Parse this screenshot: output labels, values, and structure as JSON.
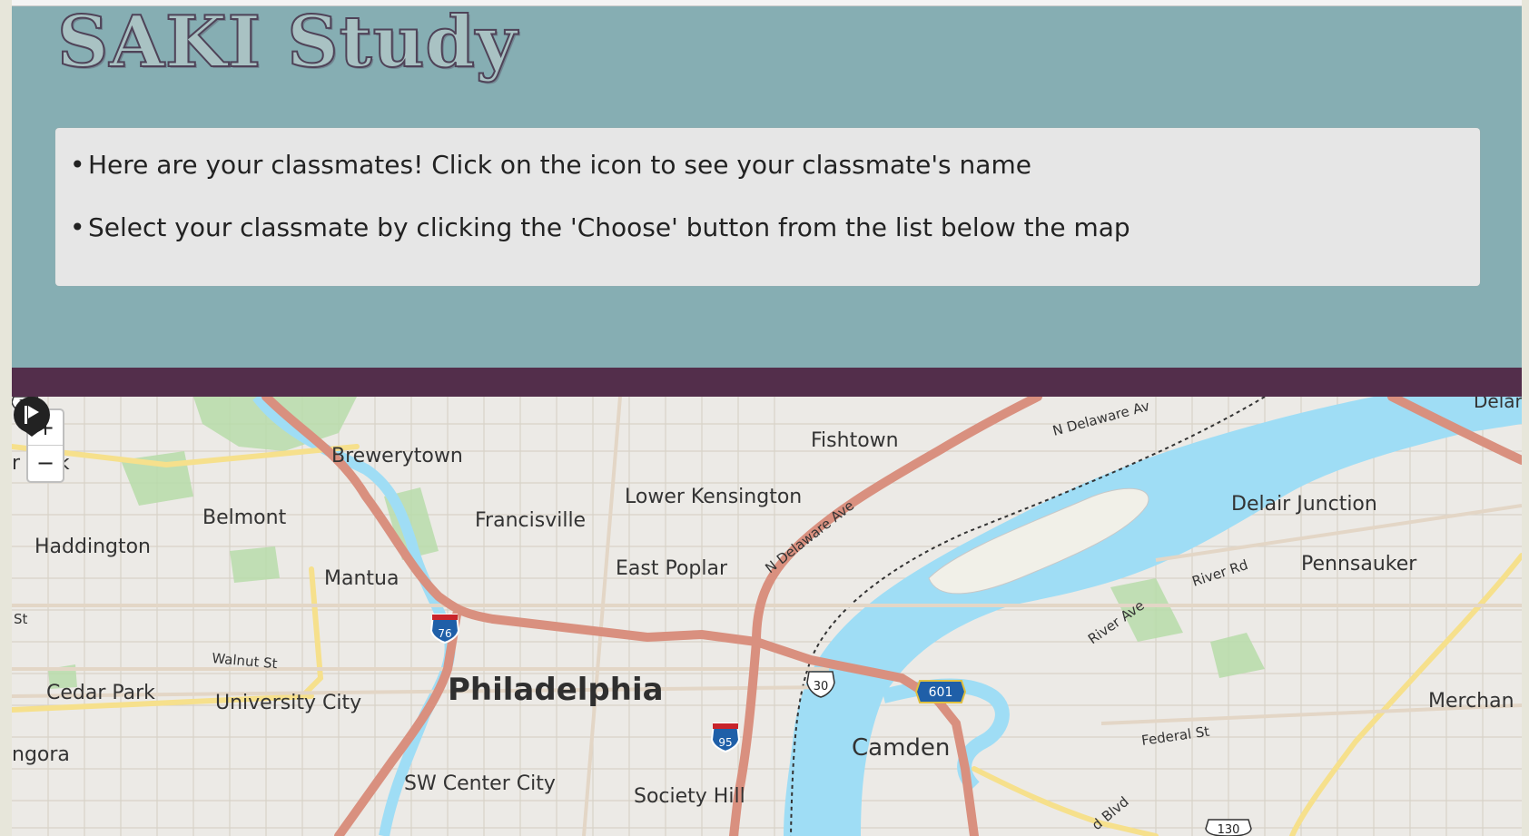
{
  "app": {
    "title": "SAKI Study"
  },
  "instructions": {
    "bullet": "•",
    "items": [
      "Here are your classmates! Click on the icon to see your classmate's name",
      "Select your classmate by clicking the 'Choose' button from the list below the map"
    ]
  },
  "map": {
    "zoom_in_label": "+",
    "zoom_out_label": "−",
    "marker_icon": "play-flag-icon",
    "places": {
      "fishtown": "Fishtown",
      "brewerytown": "Brewerytown",
      "park": "r Park",
      "belmont": "Belmont",
      "francisville": "Francisville",
      "lower_kensington": "Lower Kensington",
      "delair_junction": "Delair Junction",
      "haddington": "Haddington",
      "mantua": "Mantua",
      "east_poplar": "East Poplar",
      "pennsauken": "Pennsauker",
      "philadelphia": "Philadelphia",
      "cedar_park": "Cedar Park",
      "university_city": "University City",
      "camden": "Camden",
      "merchantville": "Merchan",
      "angora": "ngora",
      "sw_center_city": "SW Center City",
      "society_hill": "Society Hill",
      "delair_edge": "Delan"
    },
    "roads": {
      "n_delaware_ave_1": "N Delaware Ave",
      "n_delaware_ave_2": "N Delaware Av",
      "walnut_st": "Walnut St",
      "river_rd": "River Rd",
      "river_ave": "River Ave",
      "federal_st": "Federal St",
      "st": "St",
      "blvd": "d Blvd"
    },
    "shields": {
      "i76": "76",
      "i95": "95",
      "us30": "30",
      "us30_edge": "30",
      "r601": "601",
      "us130": "130"
    },
    "colors": {
      "water": "#9fddf5",
      "highway": "#d9907f",
      "arterial": "#f6e08c",
      "park": "#b8dcaa",
      "header_bg": "#86aeb3",
      "divider": "#532e4b"
    }
  }
}
